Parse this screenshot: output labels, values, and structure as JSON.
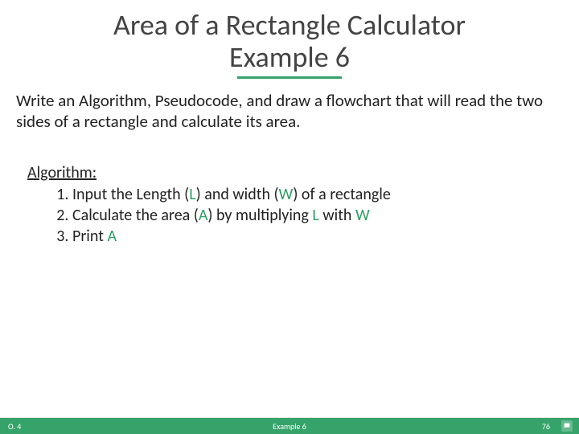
{
  "title": {
    "line1": "Area of a Rectangle Calculator",
    "line2": "Example 6"
  },
  "prompt": "Write an Algorithm, Pseudocode, and draw a flowchart that will read the two sides of a rectangle and calculate its area.",
  "algo": {
    "label": "Algorithm:",
    "steps": [
      {
        "pre": "Input the Length (",
        "v1": "L",
        "mid": ")  and width (",
        "v2": "W",
        "post": ") of a rectangle"
      },
      {
        "pre": "Calculate the area (",
        "v1": "A",
        "mid": ") by multiplying ",
        "v2": "L",
        "mid2": " with ",
        "v3": "W",
        "post": ""
      },
      {
        "pre": "Print  ",
        "v1": "A",
        "mid": "",
        "post": ""
      }
    ]
  },
  "footer": {
    "left": "O. 4",
    "center": "Example 6",
    "right": "76"
  },
  "icons": {
    "comment": "comment-icon"
  }
}
